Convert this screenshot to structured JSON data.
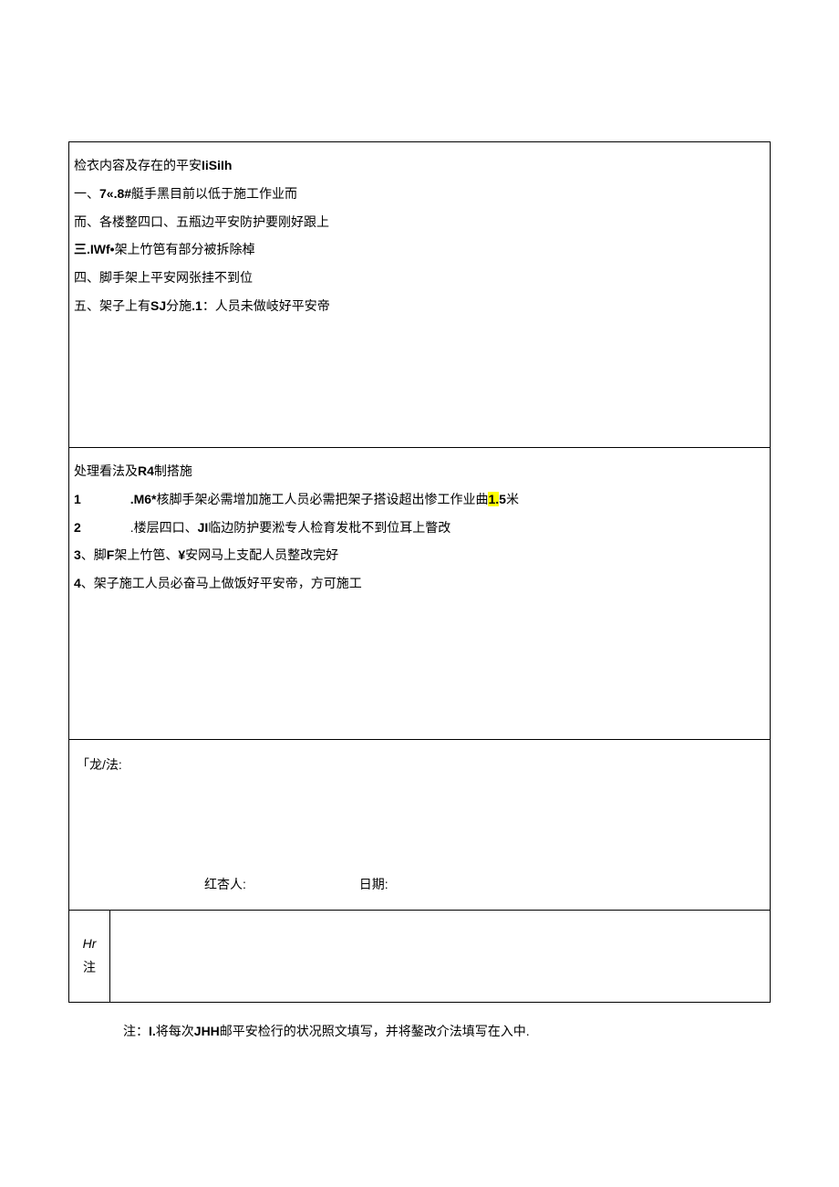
{
  "section1": {
    "title_prefix": "检衣内容及存在的平安",
    "title_suffix": "IiSiIh",
    "line1_prefix": "一、",
    "line1_bold": "7«.8#",
    "line1_text": "艇手黑目前以低于施工作业而",
    "line2": "而、各楼整四口、五瓶边平安防护要刚好跟上",
    "line3_prefix": "三",
    "line3_bold": ".IWf•",
    "line3_text": "架上竹笆有部分被拆除棹",
    "line4": "四、脚手架上平安网张挂不到位",
    "line5_prefix": "五、架子上有",
    "line5_bold1": "SJ",
    "line5_mid": "分施",
    "line5_bold2": ".1",
    "line5_text": "：人员未做岐好平安帝"
  },
  "section2": {
    "title_prefix": "处理看法及",
    "title_bold": "R4",
    "title_suffix": "制搭施",
    "line1_num": "1",
    "line1_bold": ".M6*",
    "line1_text1": "核脚手架必需增加施工人员必需把架子搭设超出惨工作业曲",
    "line1_highlight": "1.",
    "line1_bold2": "5",
    "line1_text2": "米",
    "line2_num": "2",
    "line2_text1": ".楼层四口、",
    "line2_bold": "JI",
    "line2_text2": "临边防护要淞专人检育发枇不到位耳上瞥改",
    "line3_num": "3",
    "line3_text1": "、脚",
    "line3_bold1": "F",
    "line3_text2": "架上竹笆、",
    "line3_bold2": "¥",
    "line3_text3": "安网马上支配人员整改完好",
    "line4_num": "4",
    "line4_text": "、架子施工人员必奋马上做饭好平安帝，方可施工"
  },
  "section3": {
    "label": "「龙/法:",
    "sign1": "红杏人:",
    "sign2": "日期:"
  },
  "section4": {
    "hr": "Hr",
    "zhu": "注"
  },
  "footer": {
    "prefix": "注：",
    "bold1": "I.",
    "text1": "将每次",
    "bold2": "JHH",
    "text2": "邮平安检行的状况照文填写，并将鏊改介法填写在入中."
  }
}
